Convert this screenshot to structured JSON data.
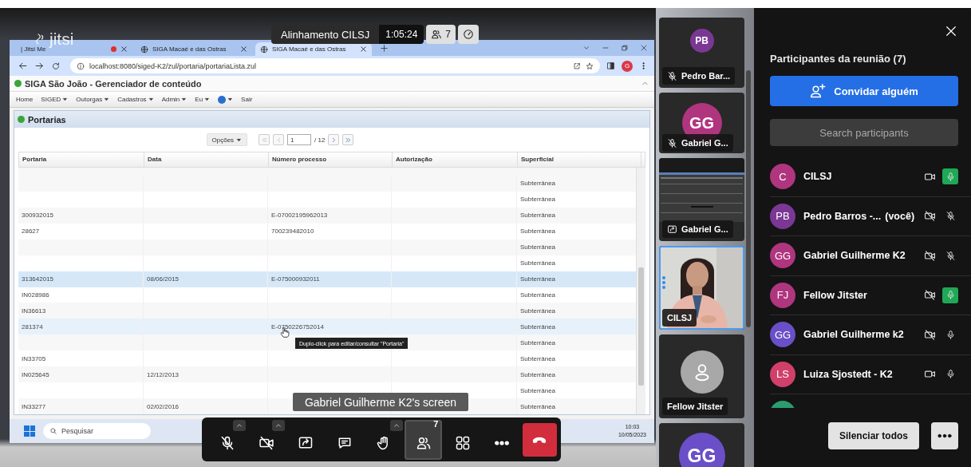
{
  "meeting_header": {
    "logo_text": "jitsi",
    "title": "Alinhamento CILSJ",
    "duration": "1:05:24",
    "participant_count": "7"
  },
  "browser": {
    "tabs": [
      {
        "title": "| Jitsi Me",
        "recording": true,
        "selected": false
      },
      {
        "title": "SIGA Macaé e das Ostras",
        "recording": false,
        "selected": false
      },
      {
        "title": "SIGA Macaé e das Ostras",
        "recording": false,
        "selected": true
      }
    ],
    "url": "localhost:8080/siged-K2/zul/portaria/portariaLista.zul",
    "profile_initial": "G"
  },
  "app": {
    "title": "SIGA São João - Gerenciador de conteúdo",
    "menu": [
      {
        "kind": "link",
        "label": "Home"
      },
      {
        "kind": "dropdown",
        "label": "SIGED"
      },
      {
        "kind": "dropdown",
        "label": "Outorgas"
      },
      {
        "kind": "dropdown",
        "label": "Cadastros"
      },
      {
        "kind": "dropdown",
        "label": "Admin"
      },
      {
        "kind": "dropdown",
        "label": "Eu"
      },
      {
        "kind": "help"
      },
      {
        "kind": "link",
        "label": "Sair"
      }
    ],
    "panel_title": "Portarias",
    "pager": {
      "options": "Opções",
      "page": "1",
      "total": "/ 12"
    },
    "table": {
      "columns": [
        "Portaria",
        "Data",
        "Número processo",
        "Autorização",
        "Superficial"
      ],
      "rows": [
        {
          "cells": [
            "",
            "",
            "",
            "",
            "Subterrânea"
          ],
          "selected": false,
          "hovered": false
        },
        {
          "cells": [
            "",
            "",
            "",
            "",
            "Subterrânea"
          ],
          "selected": false,
          "hovered": false
        },
        {
          "cells": [
            "300932015",
            "",
            "E-07002195962013",
            "",
            "Subterrânea"
          ],
          "selected": false,
          "hovered": false
        },
        {
          "cells": [
            "28627",
            "",
            "700239482010",
            "",
            "Subterrânea"
          ],
          "selected": false,
          "hovered": false
        },
        {
          "cells": [
            "",
            "",
            "",
            "",
            "Subterrânea"
          ],
          "selected": false,
          "hovered": false
        },
        {
          "cells": [
            "",
            "",
            "",
            "",
            "Subterrânea"
          ],
          "selected": false,
          "hovered": false
        },
        {
          "cells": [
            "313642015",
            "08/06/2015",
            "E-075000932011",
            "",
            "Subterrânea"
          ],
          "selected": true,
          "hovered": false
        },
        {
          "cells": [
            "IN028986",
            "",
            "",
            "",
            "Subterrânea"
          ],
          "selected": false,
          "hovered": false
        },
        {
          "cells": [
            "IN36613",
            "",
            "",
            "",
            "Subterrânea"
          ],
          "selected": false,
          "hovered": false
        },
        {
          "cells": [
            "281374",
            "",
            "E-0750226752014",
            "",
            "Subterrânea"
          ],
          "selected": false,
          "hovered": true
        },
        {
          "cells": [
            "",
            "",
            "",
            "",
            "Subterrânea"
          ],
          "selected": false,
          "hovered": false
        },
        {
          "cells": [
            "IN33705",
            "",
            "",
            "",
            "Subterrânea"
          ],
          "selected": false,
          "hovered": false
        },
        {
          "cells": [
            "IN025645",
            "12/12/2013",
            "",
            "",
            "Subterrânea"
          ],
          "selected": false,
          "hovered": false
        },
        {
          "cells": [
            "",
            "",
            "",
            "",
            "Subterrânea"
          ],
          "selected": false,
          "hovered": false
        },
        {
          "cells": [
            "IN33277",
            "02/02/2016",
            "",
            "",
            "Subterrânea"
          ],
          "selected": false,
          "hovered": false
        }
      ]
    },
    "tooltip": "Duplo-click para editar/consultar \"Portaria\""
  },
  "taskbar": {
    "search_placeholder": "Pesquisar",
    "time": "10:03",
    "date": "10/05/2023"
  },
  "screen_caption": "Gabriel Guilherme K2's screen",
  "toolbar": {
    "buttons": [
      {
        "kind": "mic",
        "off": true,
        "menu": true,
        "active": false
      },
      {
        "kind": "camera",
        "off": true,
        "menu": true,
        "active": false
      },
      {
        "kind": "share",
        "off": false,
        "menu": false,
        "active": false
      },
      {
        "kind": "chat",
        "off": false,
        "menu": false,
        "active": false
      },
      {
        "kind": "hand",
        "off": false,
        "menu": true,
        "active": false
      },
      {
        "kind": "participants",
        "off": false,
        "menu": false,
        "active": true,
        "badge": "7"
      },
      {
        "kind": "tiles",
        "off": false,
        "menu": false,
        "active": false
      },
      {
        "kind": "more",
        "off": false,
        "menu": false,
        "active": false
      },
      {
        "kind": "hangup",
        "off": false,
        "menu": false,
        "active": false
      }
    ]
  },
  "filmstrip": {
    "tiles": [
      {
        "kind": "avatar",
        "initials": "PB",
        "color": "#7a3894",
        "name": "Pedro Bar...",
        "muted": true,
        "sharing": false,
        "selected": false
      },
      {
        "kind": "avatar",
        "initials": "GG",
        "color": "#b0357f",
        "name": "Gabriel G...",
        "muted": true,
        "sharing": false,
        "selected": false
      },
      {
        "kind": "screen",
        "name": "Gabriel G...",
        "muted": false,
        "sharing": true,
        "selected": false
      },
      {
        "kind": "video",
        "name": "CILSJ",
        "selected": true
      },
      {
        "kind": "guest",
        "name": "Fellow Jitster",
        "selected": false
      },
      {
        "kind": "avatar",
        "initials": "GG",
        "color": "#6a4fc8",
        "selected": false
      }
    ]
  },
  "participants_panel": {
    "title": "Participantes da reunião (7)",
    "invite": "Convidar alguém",
    "search_placeholder": "Search participants",
    "participants": [
      {
        "initials": "C",
        "name": "CILSJ",
        "color": "#b0357f",
        "camera": true,
        "muted": false,
        "speaking": true
      },
      {
        "initials": "PB",
        "name": "Pedro Barros -...",
        "suffix": "(você)",
        "color": "#7a3894",
        "camera": false,
        "muted": true,
        "speaking": false
      },
      {
        "initials": "GG",
        "name": "Gabriel Guilherme K2",
        "color": "#b0357f",
        "camera": false,
        "muted": true,
        "speaking": false
      },
      {
        "initials": "FJ",
        "name": "Fellow Jitster",
        "color": "#b0357f",
        "camera": false,
        "muted": false,
        "speaking": true
      },
      {
        "initials": "GG",
        "name": "Gabriel Guilherme k2",
        "color": "#6a4fc8",
        "camera": false,
        "muted": false,
        "speaking": false
      },
      {
        "initials": "LS",
        "name": "Luiza Sjostedt - K2",
        "color": "#d0406a",
        "camera": true,
        "muted": false,
        "speaking": false
      },
      {
        "color": "#2a9d6f"
      }
    ],
    "mute_all": "Silenciar todos"
  }
}
